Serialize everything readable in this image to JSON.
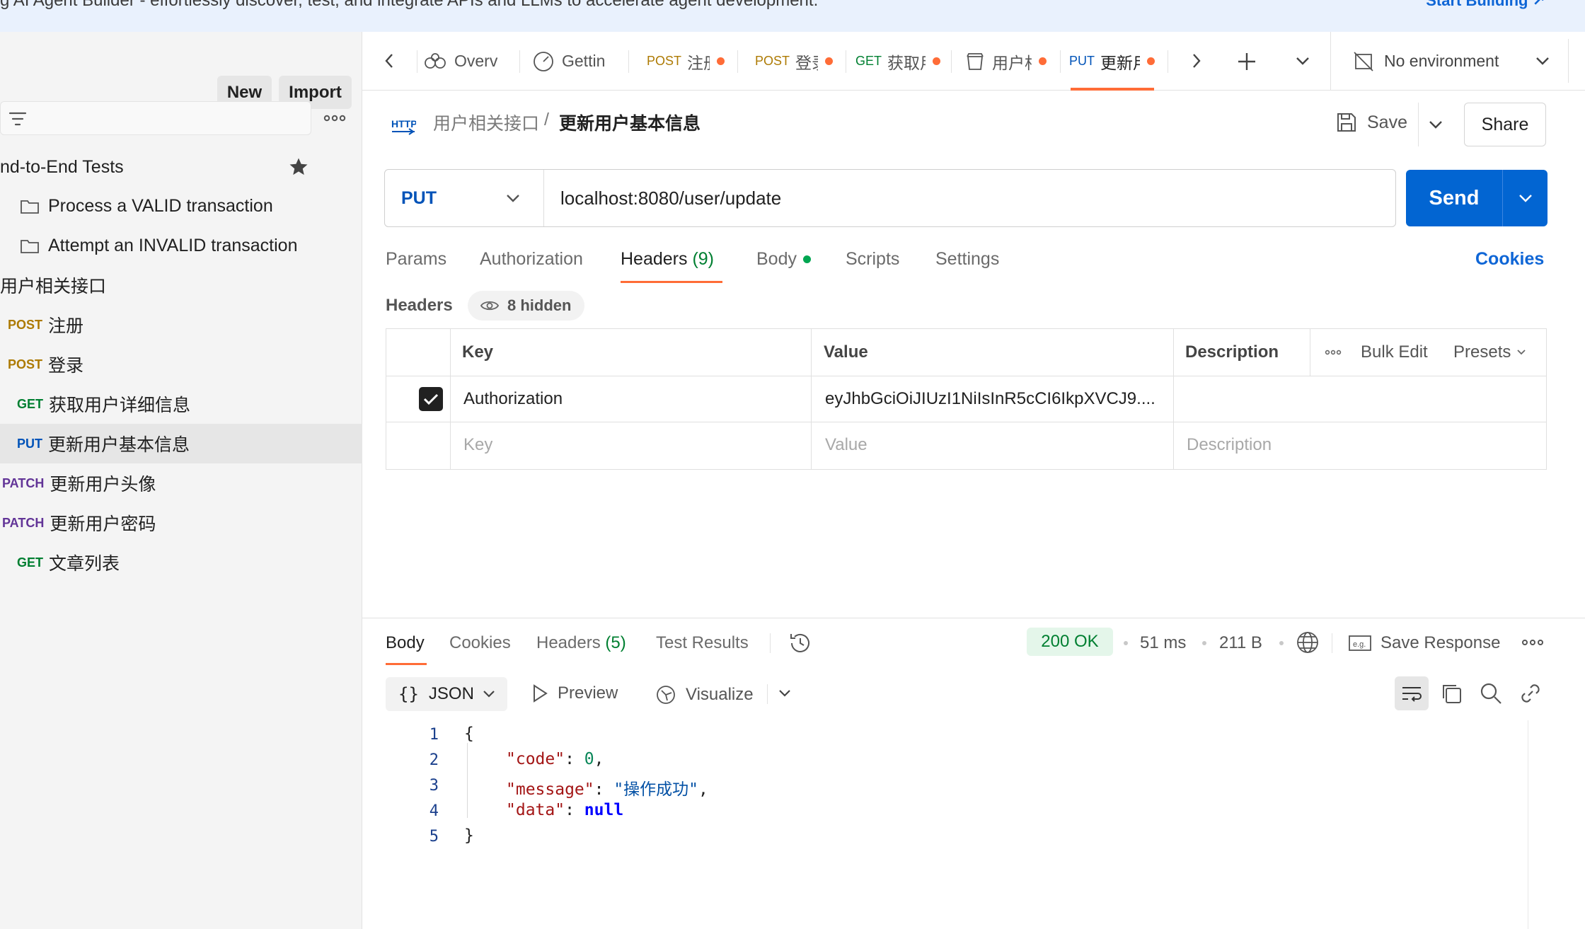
{
  "banner": {
    "text": "g AI Agent Builder - effortlessly discover, test, and integrate APIs and LLMs to accelerate agent development.",
    "cta": "Start Building ↗"
  },
  "sidebar": {
    "new_label": "New",
    "import_label": "Import",
    "tree": {
      "e2e": {
        "label": "nd-to-End Tests"
      },
      "folder1": {
        "label": "Process a VALID transaction"
      },
      "folder2": {
        "label": "Attempt an INVALID transaction"
      },
      "collection": {
        "label": "用户相关接口"
      },
      "r1": {
        "method": "POST",
        "label": "注册"
      },
      "r2": {
        "method": "POST",
        "label": "登录"
      },
      "r3": {
        "method": "GET",
        "label": "获取用户详细信息"
      },
      "r4": {
        "method": "PUT",
        "label": "更新用户基本信息"
      },
      "r5": {
        "method": "PATCH",
        "label": "更新用户头像"
      },
      "r6": {
        "method": "PATCH",
        "label": "更新用户密码"
      },
      "r7": {
        "method": "GET",
        "label": "文章列表"
      }
    }
  },
  "tabs": {
    "t1": {
      "label": "Overv"
    },
    "t2": {
      "label": "Gettin"
    },
    "t3": {
      "method": "POST",
      "label": "注册"
    },
    "t4": {
      "method": "POST",
      "label": "登录"
    },
    "t5": {
      "method": "GET",
      "label": "获取用"
    },
    "t6": {
      "label": "用户相"
    },
    "t7": {
      "method": "PUT",
      "label": "更新用"
    },
    "environment": "No environment"
  },
  "breadcrumb": {
    "http_icon": "HTTP",
    "collection": "用户相关接口",
    "separator": "/",
    "request": "更新用户基本信息"
  },
  "actions": {
    "save": "Save",
    "share": "Share"
  },
  "request": {
    "method": "PUT",
    "url": "localhost:8080/user/update",
    "send": "Send"
  },
  "request_tabs": {
    "params": "Params",
    "authorization": "Authorization",
    "headers": "Headers",
    "headers_count": "(9)",
    "body": "Body",
    "scripts": "Scripts",
    "settings": "Settings",
    "cookies": "Cookies"
  },
  "headers": {
    "title": "Headers",
    "hidden": "8 hidden",
    "columns": {
      "key": "Key",
      "value": "Value",
      "description": "Description"
    },
    "bulk_edit": "Bulk Edit",
    "presets": "Presets",
    "row": {
      "enabled": true,
      "key": "Authorization",
      "value": "eyJhbGciOiJIUzI1NiIsInR5cCI6IkpXVCJ9...."
    },
    "placeholder": {
      "key": "Key",
      "value": "Value",
      "description": "Description"
    }
  },
  "response": {
    "tabs": {
      "body": "Body",
      "cookies": "Cookies",
      "headers": "Headers",
      "headers_count": "(5)",
      "tests": "Test Results"
    },
    "status": "200 OK",
    "time": "51 ms",
    "size": "211 B",
    "save_response": "Save Response",
    "format": "JSON",
    "preview": "Preview",
    "visualize": "Visualize",
    "lines": [
      "1",
      "2",
      "3",
      "4",
      "5"
    ],
    "json": {
      "open": "{",
      "code_key": "\"code\"",
      "code_val": "0",
      "message_key": "\"message\"",
      "message_val": "\"操作成功\"",
      "data_key": "\"data\"",
      "data_val": "null",
      "close": "}"
    }
  },
  "colors": {
    "accent": "#ff6c37",
    "send": "#0265d2",
    "put": "#0053b8",
    "get": "#007f31",
    "post": "#ad7a03",
    "patch": "#623497",
    "status_ok": "#007f31"
  }
}
